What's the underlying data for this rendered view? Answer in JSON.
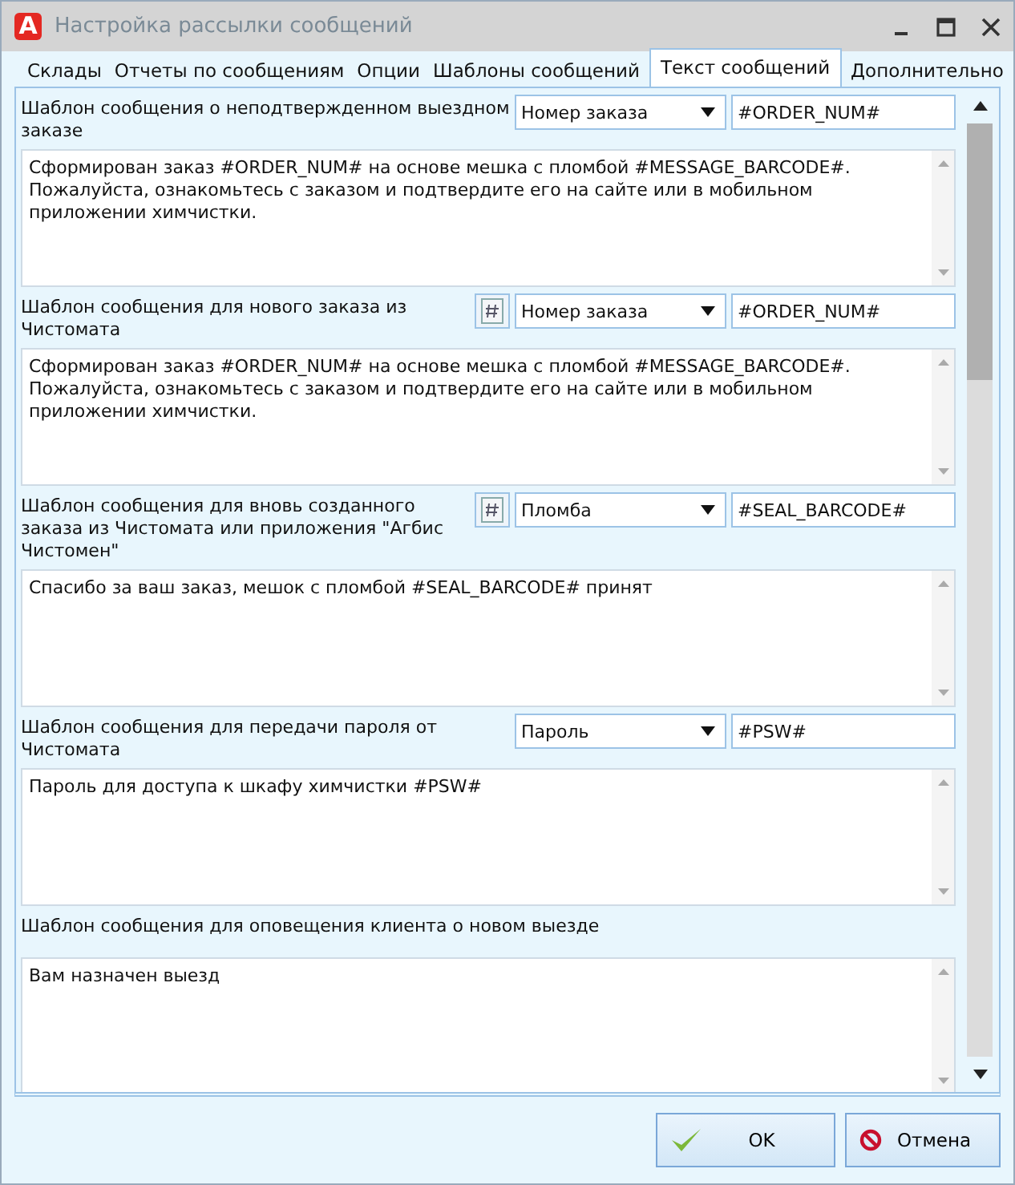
{
  "window": {
    "logo": "A",
    "title": "Настройка рассылки сообщений"
  },
  "tabs": [
    {
      "label": "Склады",
      "selected": false
    },
    {
      "label": "Отчеты по сообщениям",
      "selected": false
    },
    {
      "label": "Опции",
      "selected": false
    },
    {
      "label": "Шаблоны сообщений",
      "selected": false
    },
    {
      "label": "Текст сообщений",
      "selected": true
    },
    {
      "label": "Дополнительно",
      "selected": false
    }
  ],
  "sections": [
    {
      "label": "Шаблон сообщения о неподтвержденном выездном заказе",
      "insert_button": false,
      "combo": "Номер заказа",
      "token": "#ORDER_NUM#",
      "text": "Сформирован заказ #ORDER_NUM# на основе мешка с пломбой #MESSAGE_BARCODE#. Пожалуйста, ознакомьтесь с заказом и подтвердите его на сайте или в мобильном приложении химчистки."
    },
    {
      "label": "Шаблон сообщения для нового заказа из Чистомата",
      "insert_button": true,
      "combo": "Номер заказа",
      "token": "#ORDER_NUM#",
      "text": "Сформирован заказ #ORDER_NUM# на основе мешка с пломбой #MESSAGE_BARCODE#. Пожалуйста, ознакомьтесь с заказом и подтвердите его на сайте или в мобильном приложении химчистки."
    },
    {
      "label": "Шаблон сообщения для вновь созданного заказа из Чистомата или приложения \"Агбис Чистомен\"",
      "insert_button": true,
      "combo": "Пломба",
      "token": "#SEAL_BARCODE#",
      "text": "Спасибо за ваш заказ, мешок с пломбой #SEAL_BARCODE# принят"
    },
    {
      "label": "Шаблон сообщения для передачи пароля от Чистомата",
      "insert_button": false,
      "combo": "Пароль",
      "token": "#PSW#",
      "text": "Пароль для доступа к шкафу химчистки #PSW#"
    },
    {
      "label": "Шаблон сообщения для оповещения клиента о новом выезде",
      "insert_button": false,
      "text": "Вам назначен выезд"
    }
  ],
  "buttons": [
    {
      "kind": "ok",
      "label": "OK"
    },
    {
      "kind": "cancel",
      "label": "Отмена"
    }
  ]
}
